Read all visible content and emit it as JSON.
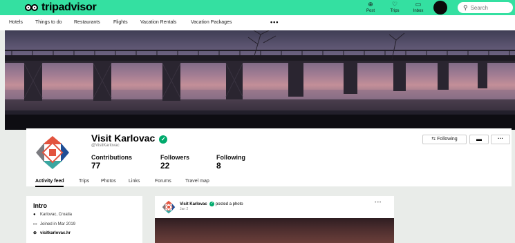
{
  "header": {
    "brand": "tripadvisor",
    "icons": [
      {
        "name": "post-icon",
        "label": "Post"
      },
      {
        "name": "trips-icon",
        "label": "Trips"
      },
      {
        "name": "inbox-icon",
        "label": "Inbox"
      }
    ],
    "search_placeholder": "Search",
    "accent": "#34e0a1"
  },
  "nav": {
    "items": [
      "Hotels",
      "Things to do",
      "Restaurants",
      "Flights",
      "Vacation Rentals",
      "Vacation Packages"
    ]
  },
  "profile": {
    "name": "Visit Karlovac",
    "handle": "@VisitKarlovac",
    "stats": [
      {
        "label": "Contributions",
        "value": "77"
      },
      {
        "label": "Followers",
        "value": "22"
      },
      {
        "label": "Following",
        "value": "8"
      }
    ],
    "following_button": "Following",
    "tabs": [
      "Activity feed",
      "Trips",
      "Photos",
      "Links",
      "Forums",
      "Travel map"
    ]
  },
  "intro": {
    "title": "Intro",
    "location": "Karlovac, Croatia",
    "joined": "Joined in Mar 2019",
    "website": "visitkarlovac.hr"
  },
  "post": {
    "author": "Visit Karlovac",
    "action": "posted a photo",
    "date": "Jan 2"
  },
  "colors": {
    "verified": "#00aa6c",
    "emblem_top": "#e2543f",
    "emblem_right": "#1f4e96",
    "emblem_bottom": "#3aa6a0",
    "emblem_left": "#7b7b80"
  }
}
